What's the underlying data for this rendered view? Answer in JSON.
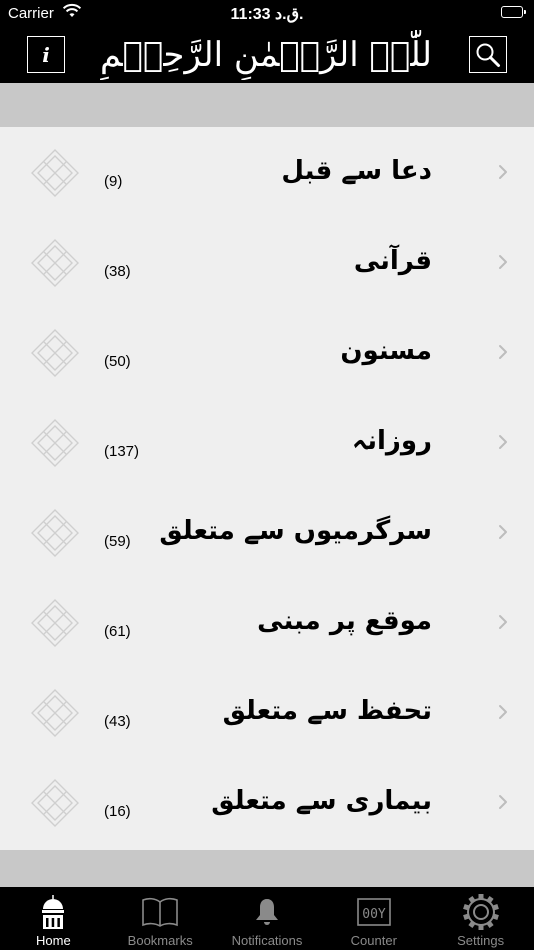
{
  "status_bar": {
    "carrier": "Carrier",
    "time": "11:33 ق.د."
  },
  "nav": {
    "title": "بِسۡمِ اللّٰہِ الرَّحۡمٰنِ الرَّحِیۡمِ",
    "info_label": "i",
    "icons": {
      "info": "info-icon",
      "search": "search-icon"
    }
  },
  "categories": [
    {
      "title": "دعا سے قبل",
      "count": "(9)"
    },
    {
      "title": "قرآنی",
      "count": "(38)"
    },
    {
      "title": "مسنون",
      "count": "(50)"
    },
    {
      "title": "روزانہ",
      "count": "(137)"
    },
    {
      "title": "سرگرمیوں سے متعلق",
      "count": "(59)"
    },
    {
      "title": "موقع پر مبنی",
      "count": "(61)"
    },
    {
      "title": "تحفظ سے متعلق",
      "count": "(43)"
    },
    {
      "title": "بیماری سے متعلق",
      "count": "(16)"
    }
  ],
  "tabs": [
    {
      "label": "Home",
      "icon": "mosque-icon",
      "active": true
    },
    {
      "label": "Bookmarks",
      "icon": "book-icon",
      "active": false
    },
    {
      "label": "Notifications",
      "icon": "bell-icon",
      "active": false
    },
    {
      "label": "Counter",
      "icon": "counter-icon",
      "active": false
    },
    {
      "label": "Settings",
      "icon": "gear-icon",
      "active": false
    }
  ],
  "colors": {
    "bar_background": "#000000",
    "list_background": "#efefef",
    "separator_band": "#c8c8c8",
    "tab_active": "#ffffff",
    "tab_inactive": "#8a8a8a"
  },
  "counter_icon_text": "00Y"
}
